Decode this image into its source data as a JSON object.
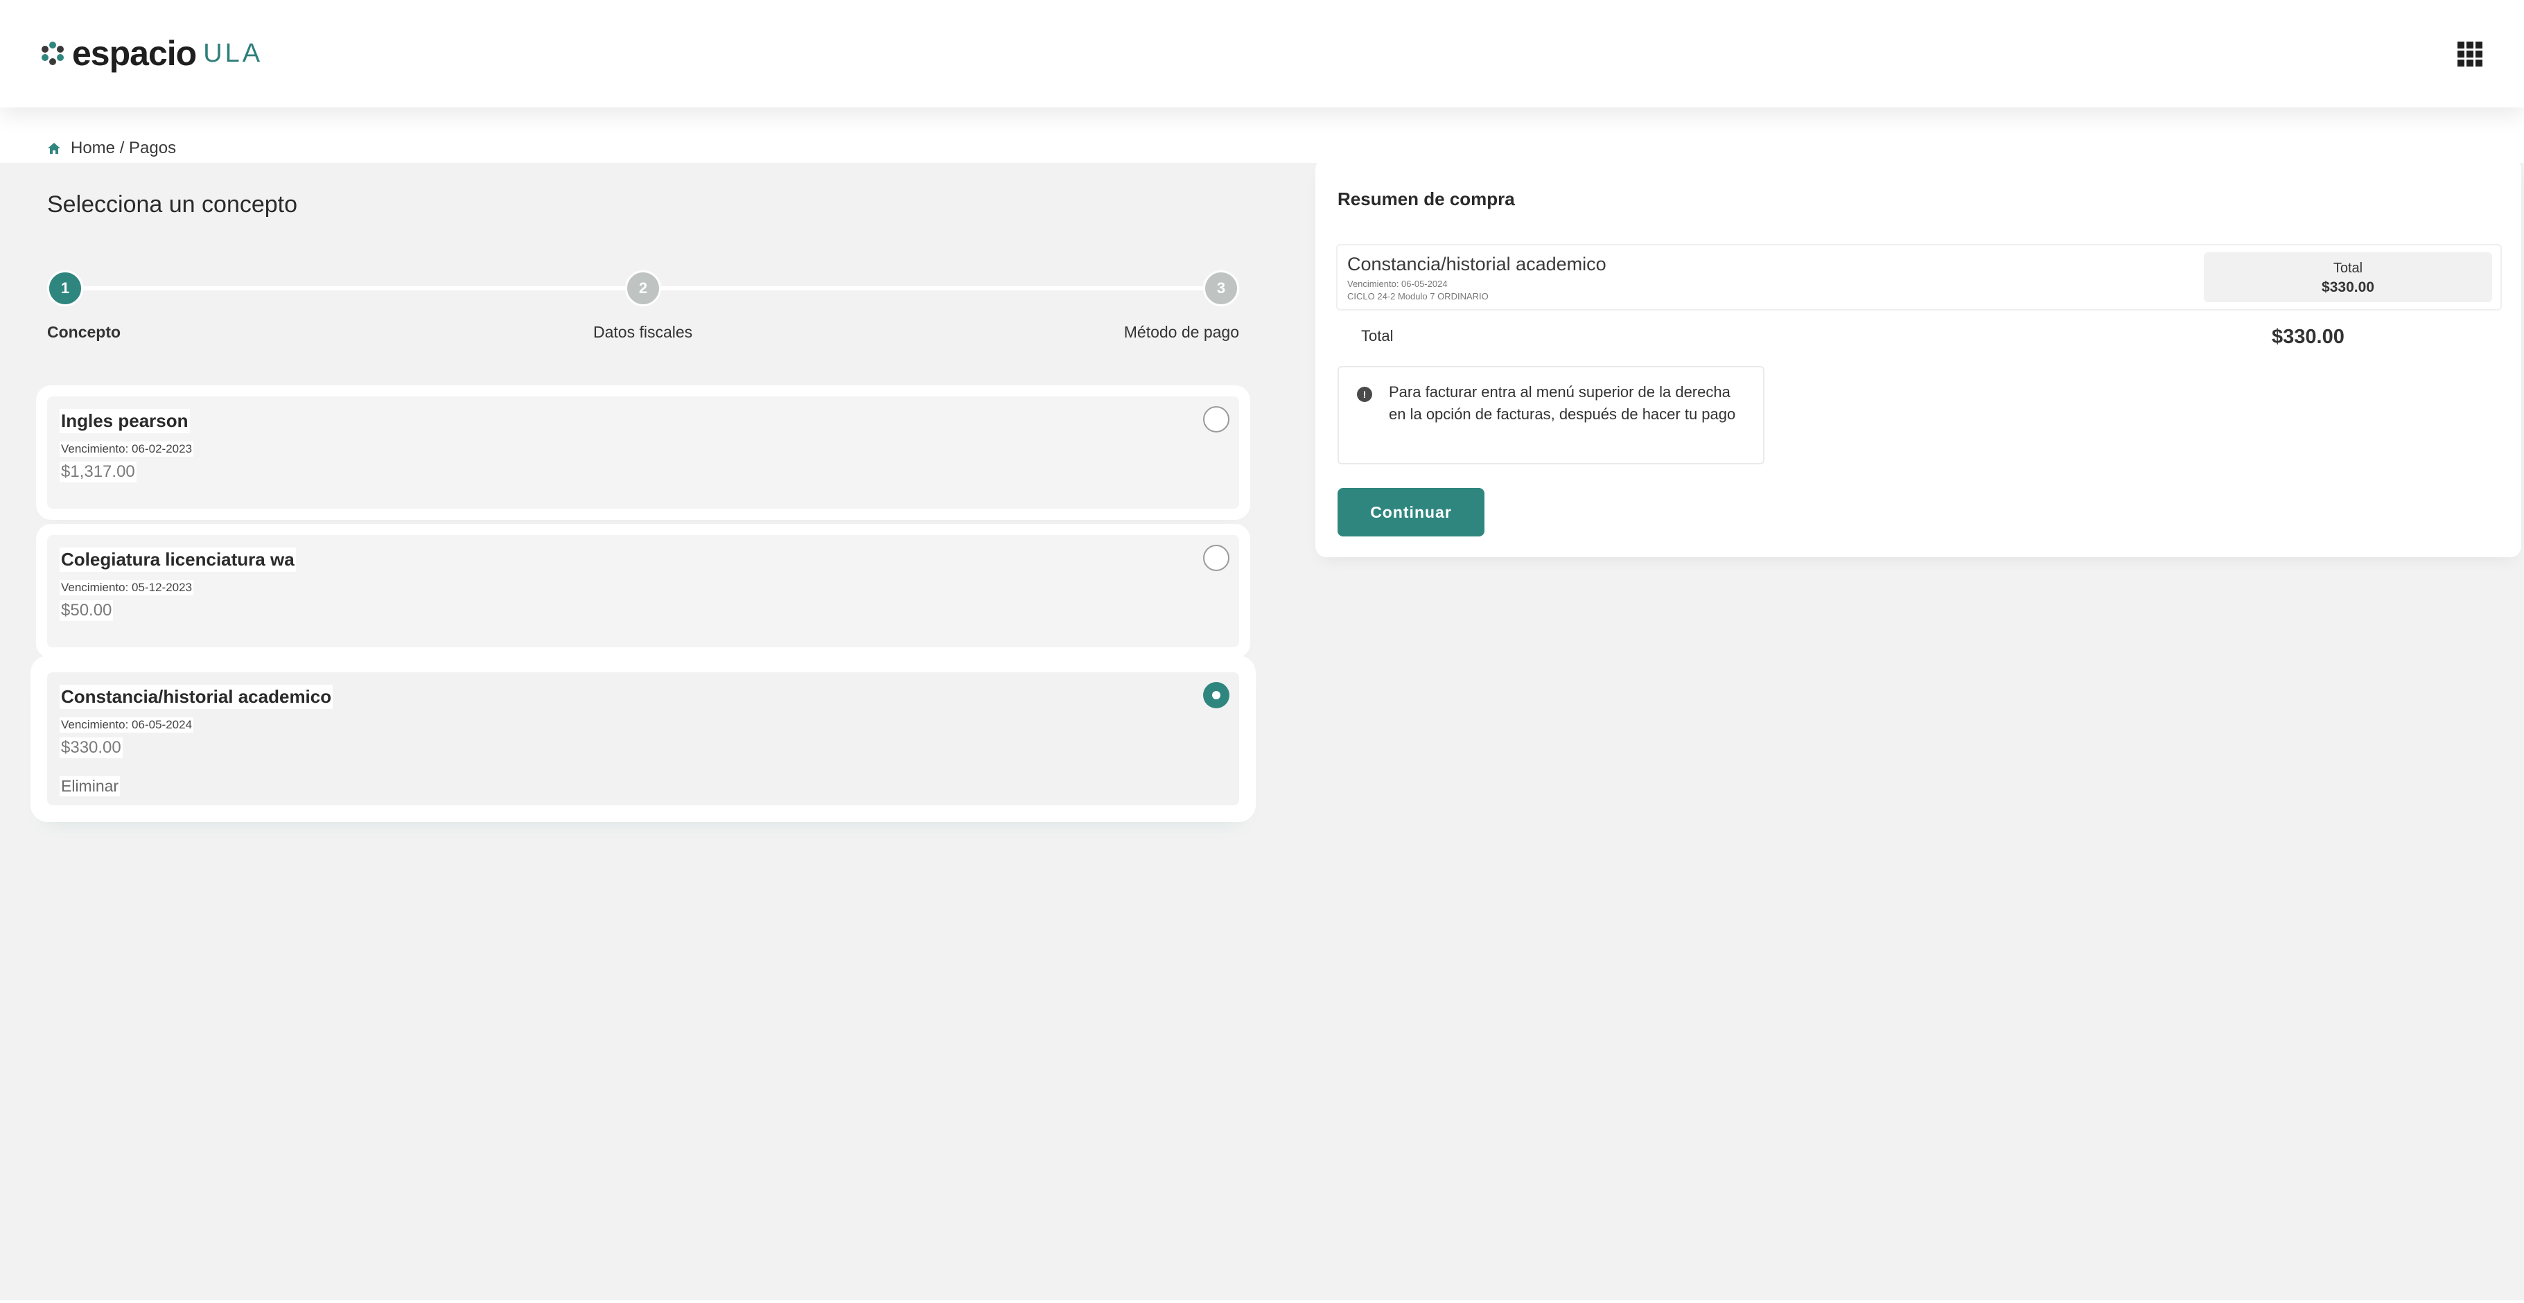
{
  "header": {
    "logo_word": "espacio",
    "logo_sub": "ULA",
    "logo_icon": "espacio-logo-mark",
    "apps_icon": "apps-grid-icon"
  },
  "breadcrumb": {
    "icon": "home-icon",
    "text": "Home / Pagos"
  },
  "page_title": "Selecciona un concepto",
  "stepper": {
    "steps": [
      {
        "number": "1",
        "label": "Concepto",
        "active": true
      },
      {
        "number": "2",
        "label": "Datos fiscales",
        "active": false
      },
      {
        "number": "3",
        "label": "Método de pago",
        "active": false
      }
    ]
  },
  "concepts": [
    {
      "title": "Ingles pearson",
      "due": "Vencimiento: 06-02-2023",
      "amount": "$1,317.00",
      "selected": false
    },
    {
      "title": "Colegiatura licenciatura wa",
      "due": "Vencimiento: 05-12-2023",
      "amount": "$50.00",
      "selected": false
    },
    {
      "title": "Constancia/historial academico",
      "due": "Vencimiento: 06-05-2024",
      "amount": "$330.00",
      "selected": true,
      "remove_label": "Eliminar"
    }
  ],
  "summary": {
    "title": "Resumen de compra",
    "item": {
      "name": "Constancia/historial academico",
      "due": "Vencimiento: 06-05-2024",
      "cycle": "CICLO 24-2 Modulo 7 ORDINARIO",
      "total_label": "Total",
      "total_value": "$330.00"
    },
    "total_label": "Total",
    "total_value": "$330.00",
    "info_icon": "info-icon",
    "info_text": "Para facturar entra al menú superior de la derecha en la opción de facturas, después de hacer tu pago",
    "continue_label": "Continuar"
  },
  "colors": {
    "accent": "#2f867f",
    "inactive_step": "#bfc4c3",
    "background": "#f2f2f2"
  }
}
